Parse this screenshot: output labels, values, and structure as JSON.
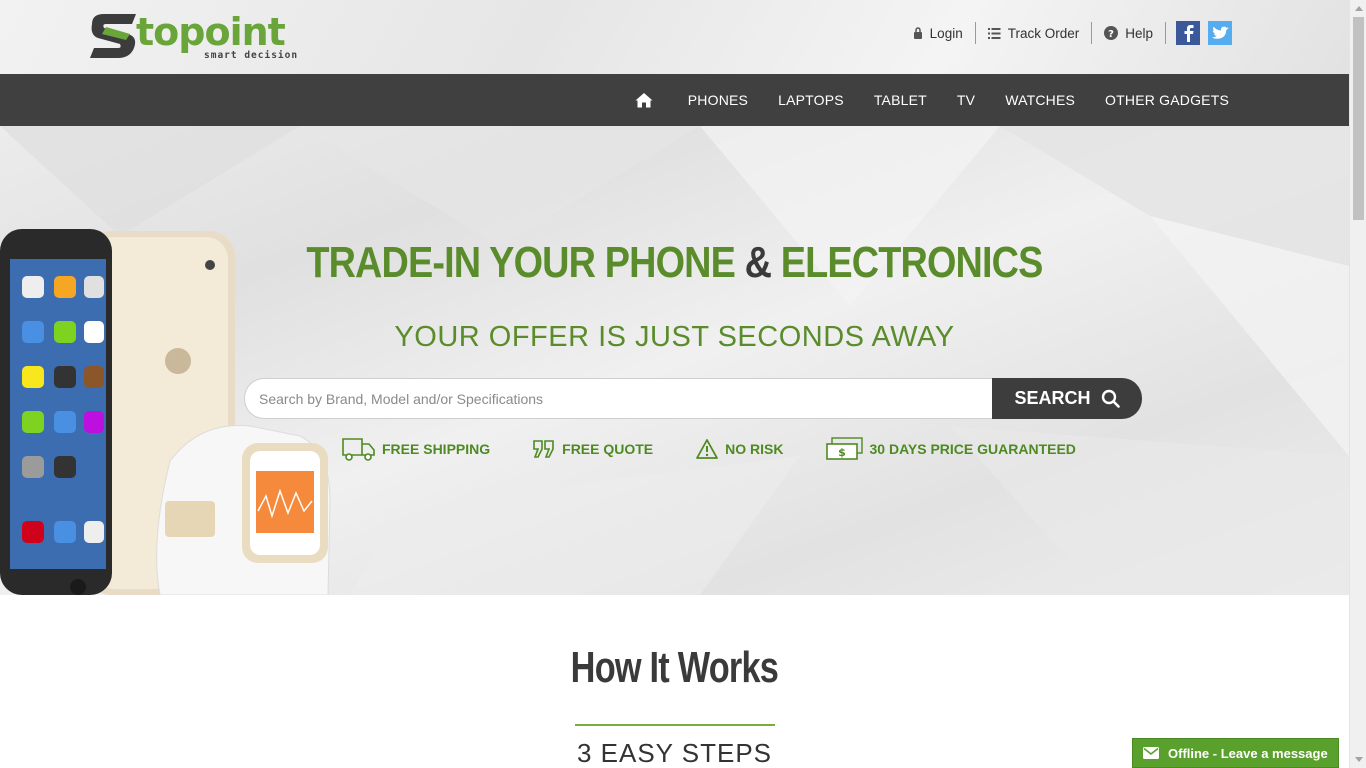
{
  "logo": {
    "text": "topoint",
    "tagline": "smart decision"
  },
  "toplinks": {
    "login": "Login",
    "track_order": "Track Order",
    "help": "Help"
  },
  "nav": {
    "items": [
      "PHONES",
      "LAPTOPS",
      "TABLET",
      "TV",
      "WATCHES",
      "OTHER GADGETS"
    ]
  },
  "hero": {
    "title_part1": "TRADE-IN YOUR PHONE",
    "title_amp": "&",
    "title_part2": "ELECTRONICS",
    "subtitle": "YOUR OFFER IS JUST SECONDS AWAY",
    "search_placeholder": "Search by Brand, Model and/or Specifications",
    "search_button": "SEARCH",
    "features": [
      "FREE SHIPPING",
      "FREE QUOTE",
      "NO RISK",
      "30 DAYS PRICE GUARANTEED"
    ]
  },
  "how": {
    "title": "How It Works",
    "subtitle": "3 EASY STEPS"
  },
  "chat": {
    "label": "Offline - Leave a message"
  },
  "colors": {
    "brand_green": "#5b8c2b",
    "nav_bg": "#404040",
    "chat_green": "#5aa02c"
  }
}
